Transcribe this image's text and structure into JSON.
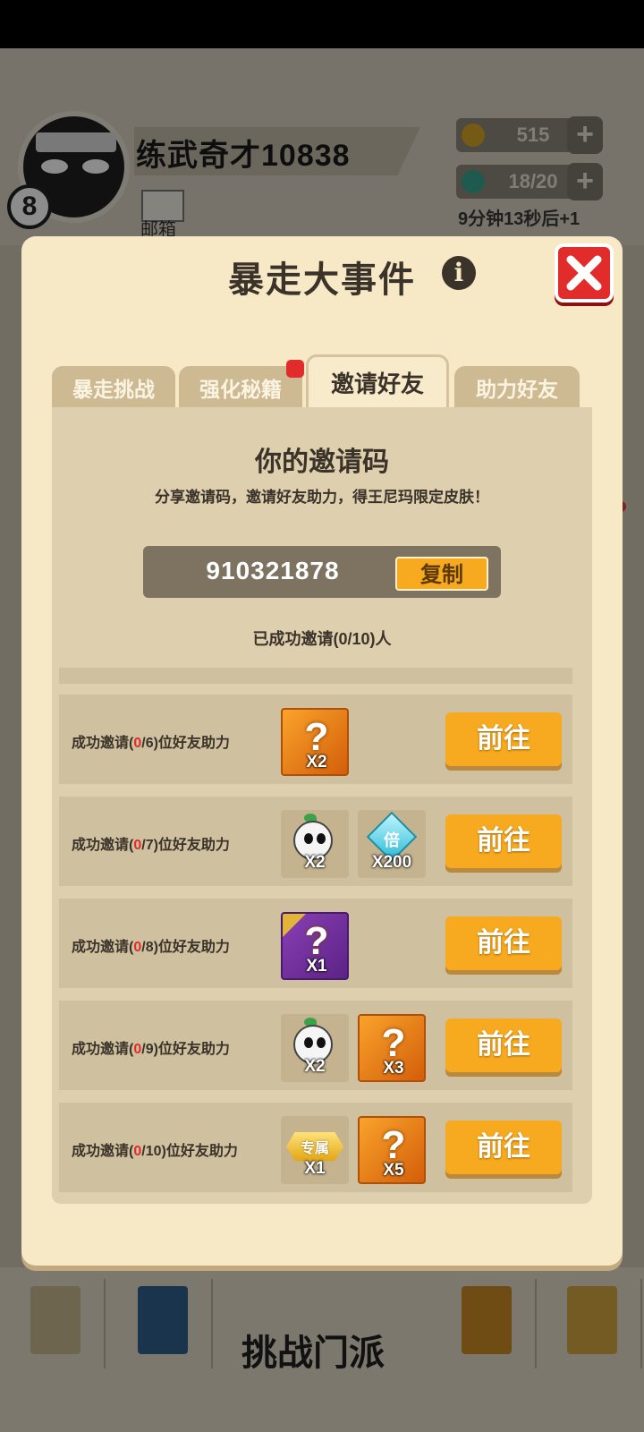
{
  "background": {
    "player_name": "练武奇才10838",
    "level": "8",
    "mail_label": "邮箱",
    "coins": "515",
    "stamina": "18/20",
    "stamina_timer": "9分钟13秒后+1",
    "center_tab_label": "挑战门派"
  },
  "modal": {
    "title": "暴走大事件",
    "tabs": [
      {
        "label": "暴走挑战"
      },
      {
        "label": "强化秘籍"
      },
      {
        "label": "邀请好友"
      },
      {
        "label": "助力好友"
      }
    ],
    "invite_title": "你的邀请码",
    "invite_desc": "分享邀请码，邀请好友助力，得王尼玛限定皮肤！",
    "invite_code": "910321878",
    "copy_label": "复制",
    "invited_count": "已成功邀请(0/10)人",
    "rows": [
      {
        "prefix": "成功邀请(",
        "done": "0",
        "suffix": "/6)位好友助力",
        "rewards": [
          {
            "qty": "X2"
          }
        ],
        "button": "前往"
      },
      {
        "prefix": "成功邀请(",
        "done": "0",
        "suffix": "/7)位好友助力",
        "rewards": [
          {
            "qty": "X2"
          },
          {
            "label": "倍",
            "qty": "X200"
          }
        ],
        "button": "前往"
      },
      {
        "prefix": "成功邀请(",
        "done": "0",
        "suffix": "/8)位好友助力",
        "rewards": [
          {
            "qty": "X1"
          }
        ],
        "button": "前往"
      },
      {
        "prefix": "成功邀请(",
        "done": "0",
        "suffix": "/9)位好友助力",
        "rewards": [
          {
            "qty": "X2"
          },
          {
            "qty": "X3"
          }
        ],
        "button": "前往"
      },
      {
        "prefix": "成功邀请(",
        "done": "0",
        "suffix": "/10)位好友助力",
        "rewards": [
          {
            "label": "专属",
            "qty": "X1"
          },
          {
            "qty": "X5"
          }
        ],
        "button": "前往"
      }
    ]
  }
}
